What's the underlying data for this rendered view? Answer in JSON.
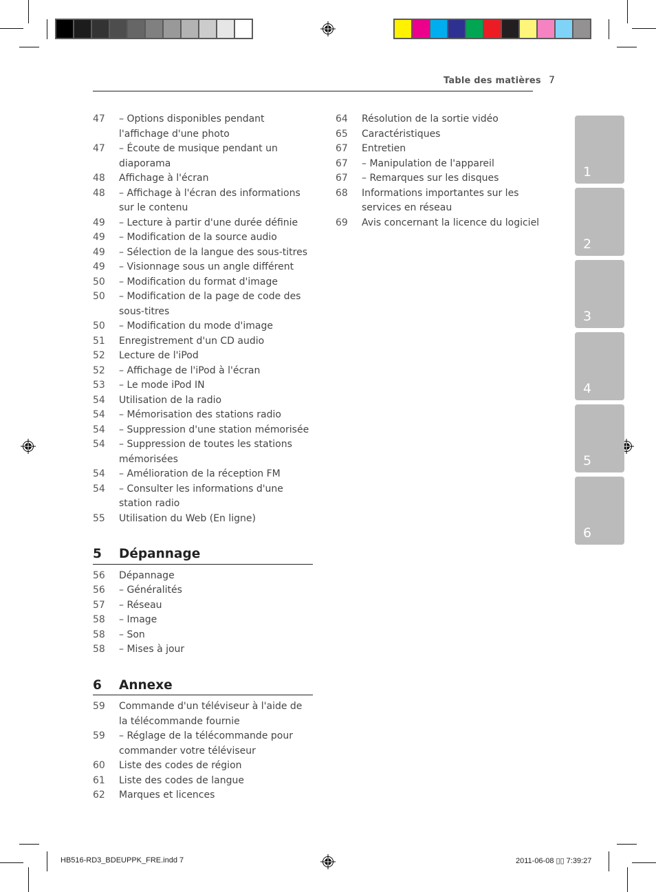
{
  "print_marks": {
    "grayscale_swatches": [
      "#000000",
      "#1c1c1c",
      "#333333",
      "#4d4d4d",
      "#666666",
      "#808080",
      "#999999",
      "#b3b3b3",
      "#cccccc",
      "#e6e6e6",
      "#ffffff"
    ],
    "color_swatches": [
      "#fff200",
      "#ec008c",
      "#00aeef",
      "#2e3192",
      "#00a651",
      "#ed1c24",
      "#231f20",
      "#fff57a",
      "#f583c2",
      "#7fd3f7",
      "#939191"
    ]
  },
  "header": {
    "title": "Table des matières",
    "page_number": "7"
  },
  "left_column": {
    "items": [
      {
        "page": "47",
        "text": "–  Options disponibles pendant l'affichage d'une photo"
      },
      {
        "page": "47",
        "text": "–  Écoute de musique pendant un diaporama"
      },
      {
        "page": "48",
        "text": "Affichage à l'écran"
      },
      {
        "page": "48",
        "text": "–  Affichage à l'écran des informations sur le contenu"
      },
      {
        "page": "49",
        "text": "–  Lecture à partir d'une durée définie"
      },
      {
        "page": "49",
        "text": "–  Modification de la source audio"
      },
      {
        "page": "49",
        "text": "–  Sélection de la langue des sous-titres"
      },
      {
        "page": "49",
        "text": "–  Visionnage sous un angle différent"
      },
      {
        "page": "50",
        "text": "–  Modification du format d'image"
      },
      {
        "page": "50",
        "text": "–  Modification de la page de code des sous-titres"
      },
      {
        "page": "50",
        "text": "–  Modification du mode d'image"
      },
      {
        "page": "51",
        "text": "Enregistrement d'un CD audio"
      },
      {
        "page": "52",
        "text": "Lecture de l'iPod"
      },
      {
        "page": "52",
        "text": "–  Affichage de l'iPod à l'écran"
      },
      {
        "page": "53",
        "text": "–  Le mode iPod IN"
      },
      {
        "page": "54",
        "text": "Utilisation de la radio"
      },
      {
        "page": "54",
        "text": "–  Mémorisation des stations radio"
      },
      {
        "page": "54",
        "text": "–  Suppression d'une station mémorisée"
      },
      {
        "page": "54",
        "text": "–  Suppression de toutes les stations mémorisées"
      },
      {
        "page": "54",
        "text": "–  Amélioration de la réception FM"
      },
      {
        "page": "54",
        "text": "–  Consulter les informations d'une station radio"
      },
      {
        "page": "55",
        "text": "Utilisation du Web (En ligne)"
      }
    ],
    "sections": [
      {
        "number": "5",
        "title": "Dépannage",
        "items": [
          {
            "page": "56",
            "text": "Dépannage"
          },
          {
            "page": "56",
            "text": "–  Généralités"
          },
          {
            "page": "57",
            "text": "–  Réseau"
          },
          {
            "page": "58",
            "text": "–  Image"
          },
          {
            "page": "58",
            "text": "–  Son"
          },
          {
            "page": "58",
            "text": "–  Mises à jour"
          }
        ]
      },
      {
        "number": "6",
        "title": "Annexe",
        "items": [
          {
            "page": "59",
            "text": "Commande d'un téléviseur à l'aide de la télécommande fournie"
          },
          {
            "page": "59",
            "text": "–  Réglage de la télécommande pour commander votre téléviseur"
          },
          {
            "page": "60",
            "text": "Liste des codes de région"
          },
          {
            "page": "61",
            "text": "Liste des codes de langue"
          },
          {
            "page": "62",
            "text": "Marques et licences"
          }
        ]
      }
    ]
  },
  "right_column": {
    "items": [
      {
        "page": "64",
        "text": "Résolution de la sortie vidéo"
      },
      {
        "page": "65",
        "text": "Caractéristiques"
      },
      {
        "page": "67",
        "text": "Entretien"
      },
      {
        "page": "67",
        "text": "–  Manipulation de l'appareil"
      },
      {
        "page": "67",
        "text": "–  Remarques sur les disques"
      },
      {
        "page": "68",
        "text": "Informations importantes sur les services en réseau"
      },
      {
        "page": "69",
        "text": "Avis concernant la licence du logiciel"
      }
    ]
  },
  "chapter_tabs": [
    "1",
    "2",
    "3",
    "4",
    "5",
    "6"
  ],
  "tab_color": "#bbbbbb",
  "footer": {
    "file_name": "HB516-RD3_BDEUPPK_FRE.indd   7",
    "timestamp": "2011-06-08   ▯▯ 7:39:27"
  }
}
